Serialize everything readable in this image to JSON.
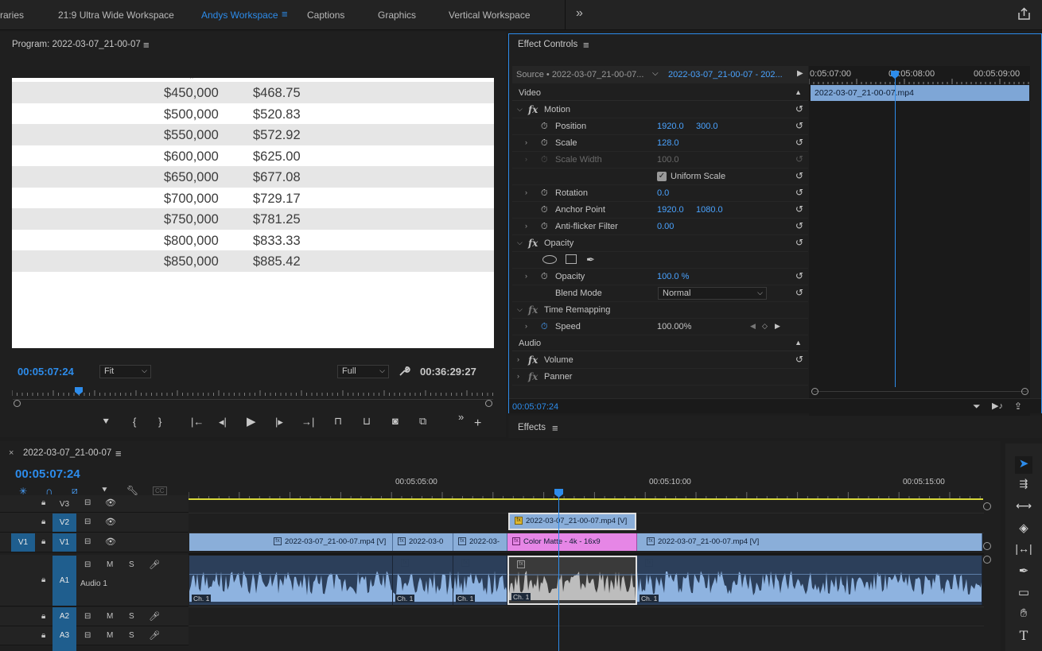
{
  "workspaces": {
    "tabs": [
      "raries",
      "21:9 Ultra Wide Workspace",
      "Andys Workspace",
      "Captions",
      "Graphics",
      "Vertical Workspace"
    ],
    "active_index": 2,
    "overflow": "»"
  },
  "program": {
    "title": "Program: 2022-03-07_21-00-07",
    "rows": [
      {
        "a": "$450,000",
        "b": "$468.75"
      },
      {
        "a": "$500,000",
        "b": "$520.83"
      },
      {
        "a": "$550,000",
        "b": "$572.92"
      },
      {
        "a": "$600,000",
        "b": "$625.00"
      },
      {
        "a": "$650,000",
        "b": "$677.08"
      },
      {
        "a": "$700,000",
        "b": "$729.17"
      },
      {
        "a": "$750,000",
        "b": "$781.25"
      },
      {
        "a": "$800,000",
        "b": "$833.33"
      },
      {
        "a": "$850,000",
        "b": "$885.42"
      }
    ],
    "timecode": "00:05:07:24",
    "fit": "Fit",
    "quality": "Full",
    "duration": "00:36:29:27"
  },
  "effect_controls": {
    "title": "Effect Controls",
    "source": "Source • 2022-03-07_21-00-07...",
    "sequence": "2022-03-07_21-00-07 - 202...",
    "ruler": [
      "0:05:07:00",
      "00:05:08:00",
      "00:05:09:00"
    ],
    "clip_name": "2022-03-07_21-00-07.mp4",
    "video_label": "Video",
    "motion": "Motion",
    "position_label": "Position",
    "position_x": "1920.0",
    "position_y": "300.0",
    "scale_label": "Scale",
    "scale_value": "128.0",
    "scale_width_label": "Scale Width",
    "scale_width_value": "100.0",
    "uniform_scale": "Uniform Scale",
    "rotation_label": "Rotation",
    "rotation_value": "0.0",
    "anchor_label": "Anchor Point",
    "anchor_x": "1920.0",
    "anchor_y": "1080.0",
    "antiflicker_label": "Anti-flicker Filter",
    "antiflicker_value": "0.00",
    "opacity_section": "Opacity",
    "opacity_label": "Opacity",
    "opacity_value": "100.0 %",
    "blend_label": "Blend Mode",
    "blend_value": "Normal",
    "time_remap": "Time Remapping",
    "speed_label": "Speed",
    "speed_value": "100.00%",
    "audio_label": "Audio",
    "volume": "Volume",
    "panner": "Panner",
    "timecode": "00:05:07:24"
  },
  "effects_panel": {
    "title": "Effects"
  },
  "timeline": {
    "sequence": "2022-03-07_21-00-07",
    "timecode": "00:05:07:24",
    "ruler": [
      "00:05:05:00",
      "00:05:10:00",
      "00:05:15:00"
    ],
    "tracks": {
      "v3": "V3",
      "v2": "V2",
      "v1": "V1",
      "src_v1": "V1",
      "a1": "A1",
      "a1_name": "Audio 1",
      "a2": "A2",
      "a3": "A3"
    },
    "clips": {
      "v2": "2022-03-07_21-00-07.mp4 [V]",
      "v1a": "2022-03-07_21-00-07.mp4 [V]",
      "v1b": "2022-03-0",
      "v1c": "2022-03-",
      "matte": "Color Matte - 4k - 16x9",
      "v1d": "2022-03-07_21-00-07.mp4 [V]",
      "ch": "Ch. 1"
    },
    "msm": {
      "m": "M",
      "s": "S"
    }
  },
  "colors": {
    "accent": "#2d8ceb",
    "clip": "#8aaed9",
    "matte": "#e686e6",
    "audio": "#2c3f5a"
  }
}
